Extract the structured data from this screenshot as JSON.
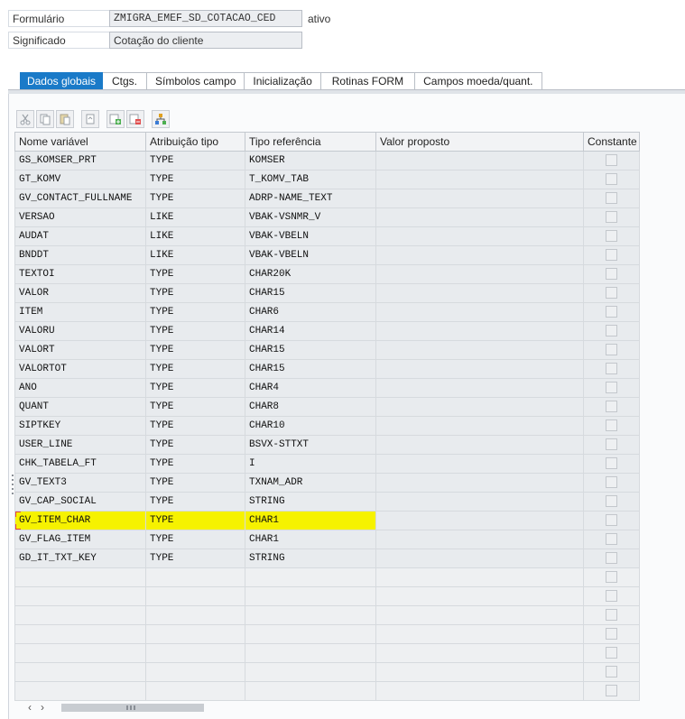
{
  "header": {
    "formulario_label": "Formulário",
    "formulario_value": "ZMIGRA_EMEF_SD_COTACAO_CED",
    "status": "ativo",
    "significado_label": "Significado",
    "significado_value": "Cotação do cliente"
  },
  "tabs": [
    {
      "label": "Dados globais",
      "active": true
    },
    {
      "label": "Ctgs.",
      "active": false
    },
    {
      "label": "Símbolos campo",
      "active": false
    },
    {
      "label": "Inicialização",
      "active": false
    },
    {
      "label": "Rotinas FORM",
      "active": false
    },
    {
      "label": "Campos moeda/quant.",
      "active": false
    }
  ],
  "toolbar": {
    "icons": [
      "cut-icon",
      "copy-icon",
      "paste-icon",
      "undo-icon",
      "insert-row-icon",
      "delete-row-icon",
      "hierarchy-icon"
    ]
  },
  "table": {
    "columns": [
      "Nome variável",
      "Atribuição tipo",
      "Tipo referência",
      "Valor proposto",
      "Constante"
    ],
    "rows": [
      {
        "name": "GS_KOMSER_PRT",
        "assign": "TYPE",
        "ref": "KOMSER",
        "value": "",
        "highlight": false
      },
      {
        "name": "GT_KOMV",
        "assign": "TYPE",
        "ref": "T_KOMV_TAB",
        "value": "",
        "highlight": false
      },
      {
        "name": "GV_CONTACT_FULLNAME",
        "assign": "TYPE",
        "ref": "ADRP-NAME_TEXT",
        "value": "",
        "highlight": false
      },
      {
        "name": "VERSAO",
        "assign": "LIKE",
        "ref": "VBAK-VSNMR_V",
        "value": "",
        "highlight": false
      },
      {
        "name": "AUDAT",
        "assign": "LIKE",
        "ref": "VBAK-VBELN",
        "value": "",
        "highlight": false
      },
      {
        "name": "BNDDT",
        "assign": "LIKE",
        "ref": "VBAK-VBELN",
        "value": "",
        "highlight": false
      },
      {
        "name": "TEXTOI",
        "assign": "TYPE",
        "ref": "CHAR20K",
        "value": "",
        "highlight": false
      },
      {
        "name": "VALOR",
        "assign": "TYPE",
        "ref": "CHAR15",
        "value": "",
        "highlight": false
      },
      {
        "name": "ITEM",
        "assign": "TYPE",
        "ref": "CHAR6",
        "value": "",
        "highlight": false
      },
      {
        "name": "VALORU",
        "assign": "TYPE",
        "ref": "CHAR14",
        "value": "",
        "highlight": false
      },
      {
        "name": "VALORT",
        "assign": "TYPE",
        "ref": "CHAR15",
        "value": "",
        "highlight": false
      },
      {
        "name": "VALORTOT",
        "assign": "TYPE",
        "ref": "CHAR15",
        "value": "",
        "highlight": false
      },
      {
        "name": "ANO",
        "assign": "TYPE",
        "ref": "CHAR4",
        "value": "",
        "highlight": false
      },
      {
        "name": "QUANT",
        "assign": "TYPE",
        "ref": "CHAR8",
        "value": "",
        "highlight": false
      },
      {
        "name": "SIPTKEY",
        "assign": "TYPE",
        "ref": "CHAR10",
        "value": "",
        "highlight": false
      },
      {
        "name": "USER_LINE",
        "assign": "TYPE",
        "ref": "BSVX-STTXT",
        "value": "",
        "highlight": false
      },
      {
        "name": "CHK_TABELA_FT",
        "assign": "TYPE",
        "ref": "I",
        "value": "",
        "highlight": false
      },
      {
        "name": "GV_TEXT3",
        "assign": "TYPE",
        "ref": "TXNAM_ADR",
        "value": "",
        "highlight": false
      },
      {
        "name": "GV_CAP_SOCIAL",
        "assign": "TYPE",
        "ref": "STRING",
        "value": "",
        "highlight": false
      },
      {
        "name": "GV_ITEM_CHAR",
        "assign": "TYPE",
        "ref": "CHAR1",
        "value": "",
        "highlight": true
      },
      {
        "name": "GV_FLAG_ITEM",
        "assign": "TYPE",
        "ref": "CHAR1",
        "value": "",
        "highlight": false
      },
      {
        "name": "GD_IT_TXT_KEY",
        "assign": "TYPE",
        "ref": "STRING",
        "value": "",
        "highlight": false
      }
    ],
    "empty_rows": 7
  },
  "scrollbar": {
    "left_arrow": "‹",
    "right_arrow": "›"
  }
}
